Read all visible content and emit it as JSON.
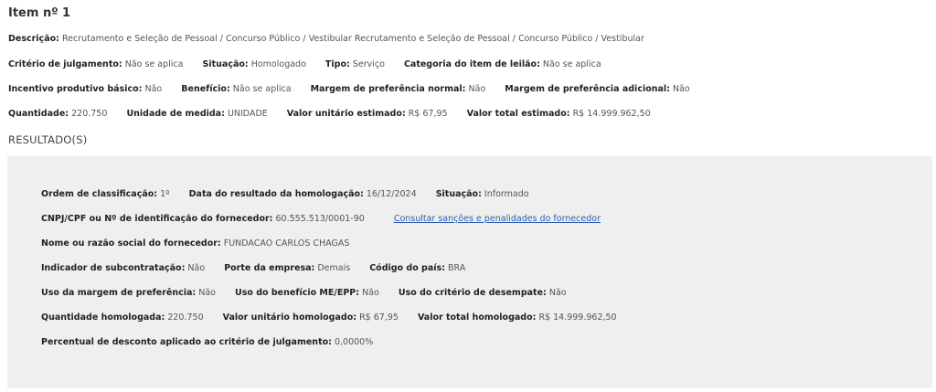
{
  "item": {
    "title": "Item nº 1",
    "descricao": {
      "label": "Descrição:",
      "value": "Recrutamento e Seleção de Pessoal / Concurso Público / Vestibular Recrutamento e Seleção de Pessoal / Concurso Público / Vestibular"
    },
    "criterio": {
      "label": "Critério de julgamento:",
      "value": "Não se aplica"
    },
    "situacao": {
      "label": "Situação:",
      "value": "Homologado"
    },
    "tipo": {
      "label": "Tipo:",
      "value": "Serviço"
    },
    "categoria": {
      "label": "Categoria do item de leilão:",
      "value": "Não se aplica"
    },
    "incentivo": {
      "label": "Incentivo produtivo básico:",
      "value": "Não"
    },
    "beneficio": {
      "label": "Benefício:",
      "value": "Não se aplica"
    },
    "margem_normal": {
      "label": "Margem de preferência normal:",
      "value": "Não"
    },
    "margem_adicional": {
      "label": "Margem de preferência adicional:",
      "value": "Não"
    },
    "quantidade": {
      "label": "Quantidade:",
      "value": "220.750"
    },
    "unidade": {
      "label": "Unidade de medida:",
      "value": "UNIDADE"
    },
    "valor_unitario": {
      "label": "Valor unitário estimado:",
      "value": "R$ 67,95"
    },
    "valor_total": {
      "label": "Valor total estimado:",
      "value": "R$ 14.999.962,50"
    }
  },
  "results": {
    "title": "RESULTADO(S)",
    "ordem": {
      "label": "Ordem de classificação:",
      "value": "1º"
    },
    "data_resultado": {
      "label": "Data do resultado da homologação:",
      "value": "16/12/2024"
    },
    "situacao": {
      "label": "Situação:",
      "value": "Informado"
    },
    "cnpj": {
      "label": "CNPJ/CPF ou Nº de identificação do fornecedor:",
      "value": "60.555.513/0001-90"
    },
    "consultar_link": "Consultar sanções e penalidades do fornecedor",
    "nome": {
      "label": "Nome ou razão social do fornecedor:",
      "value": "FUNDACAO CARLOS CHAGAS"
    },
    "subcontratacao": {
      "label": "Indicador de subcontratação:",
      "value": "Não"
    },
    "porte": {
      "label": "Porte da empresa:",
      "value": "Demais"
    },
    "codigo_pais": {
      "label": "Código do país:",
      "value": "BRA"
    },
    "uso_margem": {
      "label": "Uso da margem de preferência:",
      "value": "Não"
    },
    "uso_beneficio": {
      "label": "Uso do benefício ME/EPP:",
      "value": "Não"
    },
    "uso_criterio": {
      "label": "Uso do critério de desempate:",
      "value": "Não"
    },
    "qtd_homologada": {
      "label": "Quantidade homologada:",
      "value": "220.750"
    },
    "valor_unit_homologado": {
      "label": "Valor unitário homologado:",
      "value": "R$ 67,95"
    },
    "valor_total_homologado": {
      "label": "Valor total homologado:",
      "value": "R$ 14.999.962,50"
    },
    "percentual": {
      "label": "Percentual de desconto aplicado ao critério de julgamento:",
      "value": "0,0000%"
    }
  },
  "colors": {
    "panel_background": "#efefef",
    "link": "#2a5db0"
  }
}
